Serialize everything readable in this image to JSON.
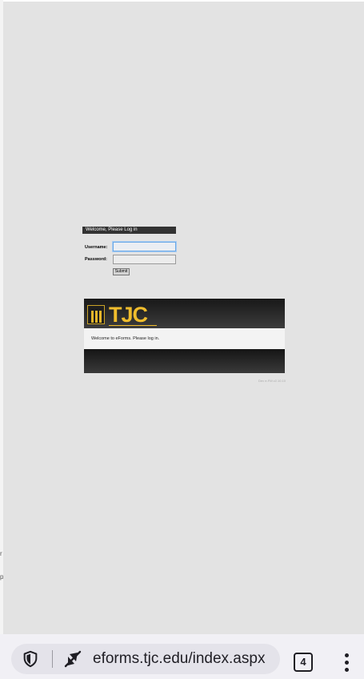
{
  "login": {
    "header": "Welcome, Please Log in",
    "username_label": "Username:",
    "password_label": "Password:",
    "username_value": "",
    "password_value": "",
    "submit_label": "Submit"
  },
  "banner": {
    "logo_text": "TJC",
    "welcome_text": "Welcome to eForms. Please log in.",
    "version_text": "Dev e-FM v2.10.10"
  },
  "edge_fragments": [
    "r",
    "p"
  ],
  "browser": {
    "url": "eforms.tjc.edu/index.aspx",
    "tab_count": "4"
  },
  "colors": {
    "page_background": "#e3e3e3",
    "logo_gold": "#f0bd2d",
    "banner_dark": "#333333"
  }
}
